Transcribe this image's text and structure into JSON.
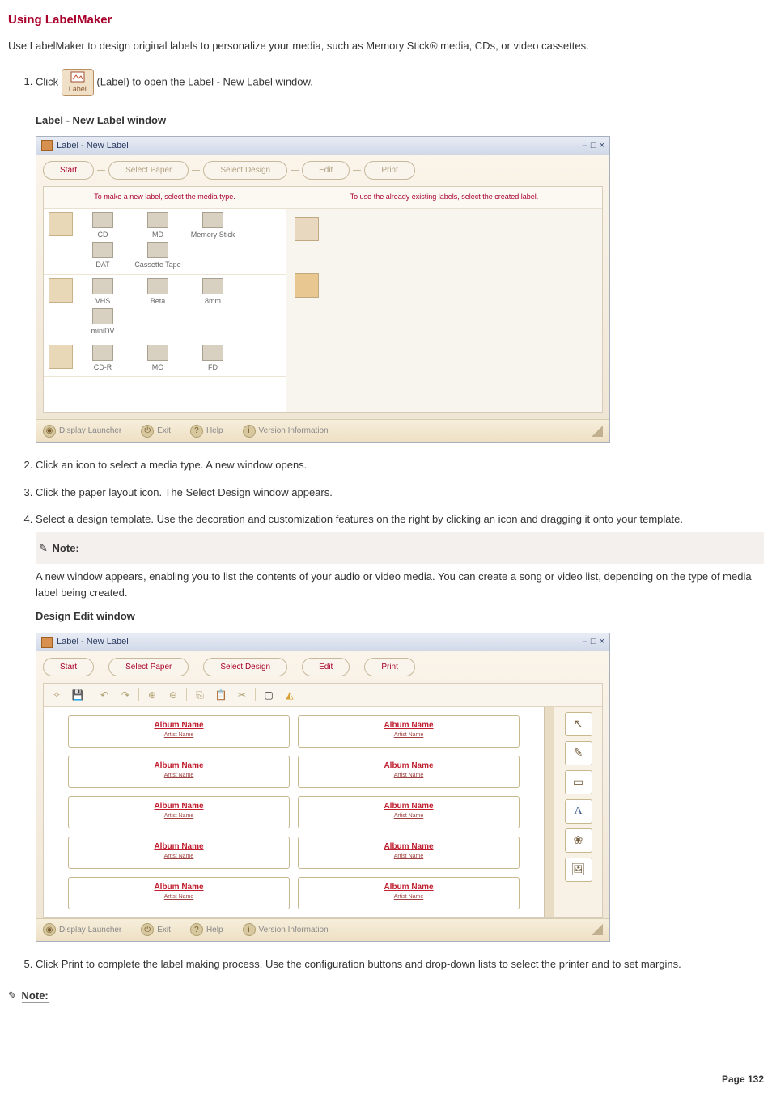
{
  "title": "Using LabelMaker",
  "intro": "Use LabelMaker to design original labels to personalize your media, such as Memory Stick® media, CDs, or video cassettes.",
  "steps": {
    "s1_before": "Click ",
    "s1_after": " (Label) to open the Label - New Label window.",
    "s2": "Click an icon to select a media type. A new window opens.",
    "s3": "Click the paper layout icon. The Select Design window appears.",
    "s4": "Select a design template. Use the decoration and customization features on the right by clicking an icon and dragging it onto your template.",
    "s5": "Click Print to complete the label making process. Use the configuration buttons and drop-down lists to select the printer and to set margins."
  },
  "label_icon_text": "Label",
  "captions": {
    "new_label_window": "Label - New Label window",
    "design_edit_window": "Design Edit window"
  },
  "note": {
    "heading": "Note:",
    "body": "A new window appears, enabling you to list the contents of your audio or video media. You can create a song or video list, depending on the type of media label being created."
  },
  "app": {
    "title": "Label - New Label",
    "wizard": [
      "Start",
      "Select Paper",
      "Select Design",
      "Edit",
      "Print"
    ],
    "pane_left_hdr": "To make a new label, select the media type.",
    "pane_right_hdr": "To use the already existing labels, select the created label.",
    "media_row1": [
      "CD",
      "MD",
      "Memory Stick"
    ],
    "media_row1b": [
      "DAT",
      "Cassette Tape"
    ],
    "media_row2": [
      "VHS",
      "Beta",
      "8mm"
    ],
    "media_row2b": [
      "miniDV"
    ],
    "media_row3": [
      "CD-R",
      "MO",
      "FD"
    ],
    "footer": {
      "launcher": "Display Launcher",
      "exit": "Exit",
      "help": "Help",
      "version": "Version Information"
    }
  },
  "edit": {
    "wizard_active": 3,
    "album_name": "Album Name",
    "artist_name": "Artist Name"
  },
  "page_number": "Page 132",
  "bottom_note": "Note:"
}
